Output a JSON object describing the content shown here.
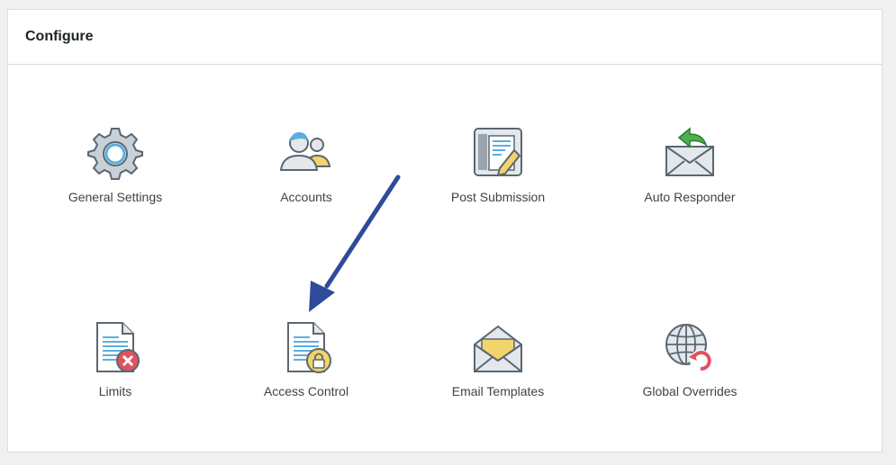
{
  "panel": {
    "title": "Configure"
  },
  "tiles": [
    {
      "label": "General Settings",
      "icon": "gear-icon"
    },
    {
      "label": "Accounts",
      "icon": "users-icon"
    },
    {
      "label": "Post Submission",
      "icon": "post-edit-icon"
    },
    {
      "label": "Auto Responder",
      "icon": "envelope-reply-icon"
    },
    {
      "label": "Limits",
      "icon": "document-x-icon"
    },
    {
      "label": "Access Control",
      "icon": "document-lock-icon"
    },
    {
      "label": "Email Templates",
      "icon": "open-envelope-icon"
    },
    {
      "label": "Global Overrides",
      "icon": "globe-refresh-icon"
    }
  ],
  "colors": {
    "accent_arrow": "#2e4b9a",
    "icon_gray": "#5b6770",
    "icon_light": "#e3e8ed",
    "icon_blue": "#5aaee0",
    "icon_yellow": "#f3d36b",
    "icon_red": "#e0525e",
    "icon_green": "#4caf50"
  }
}
